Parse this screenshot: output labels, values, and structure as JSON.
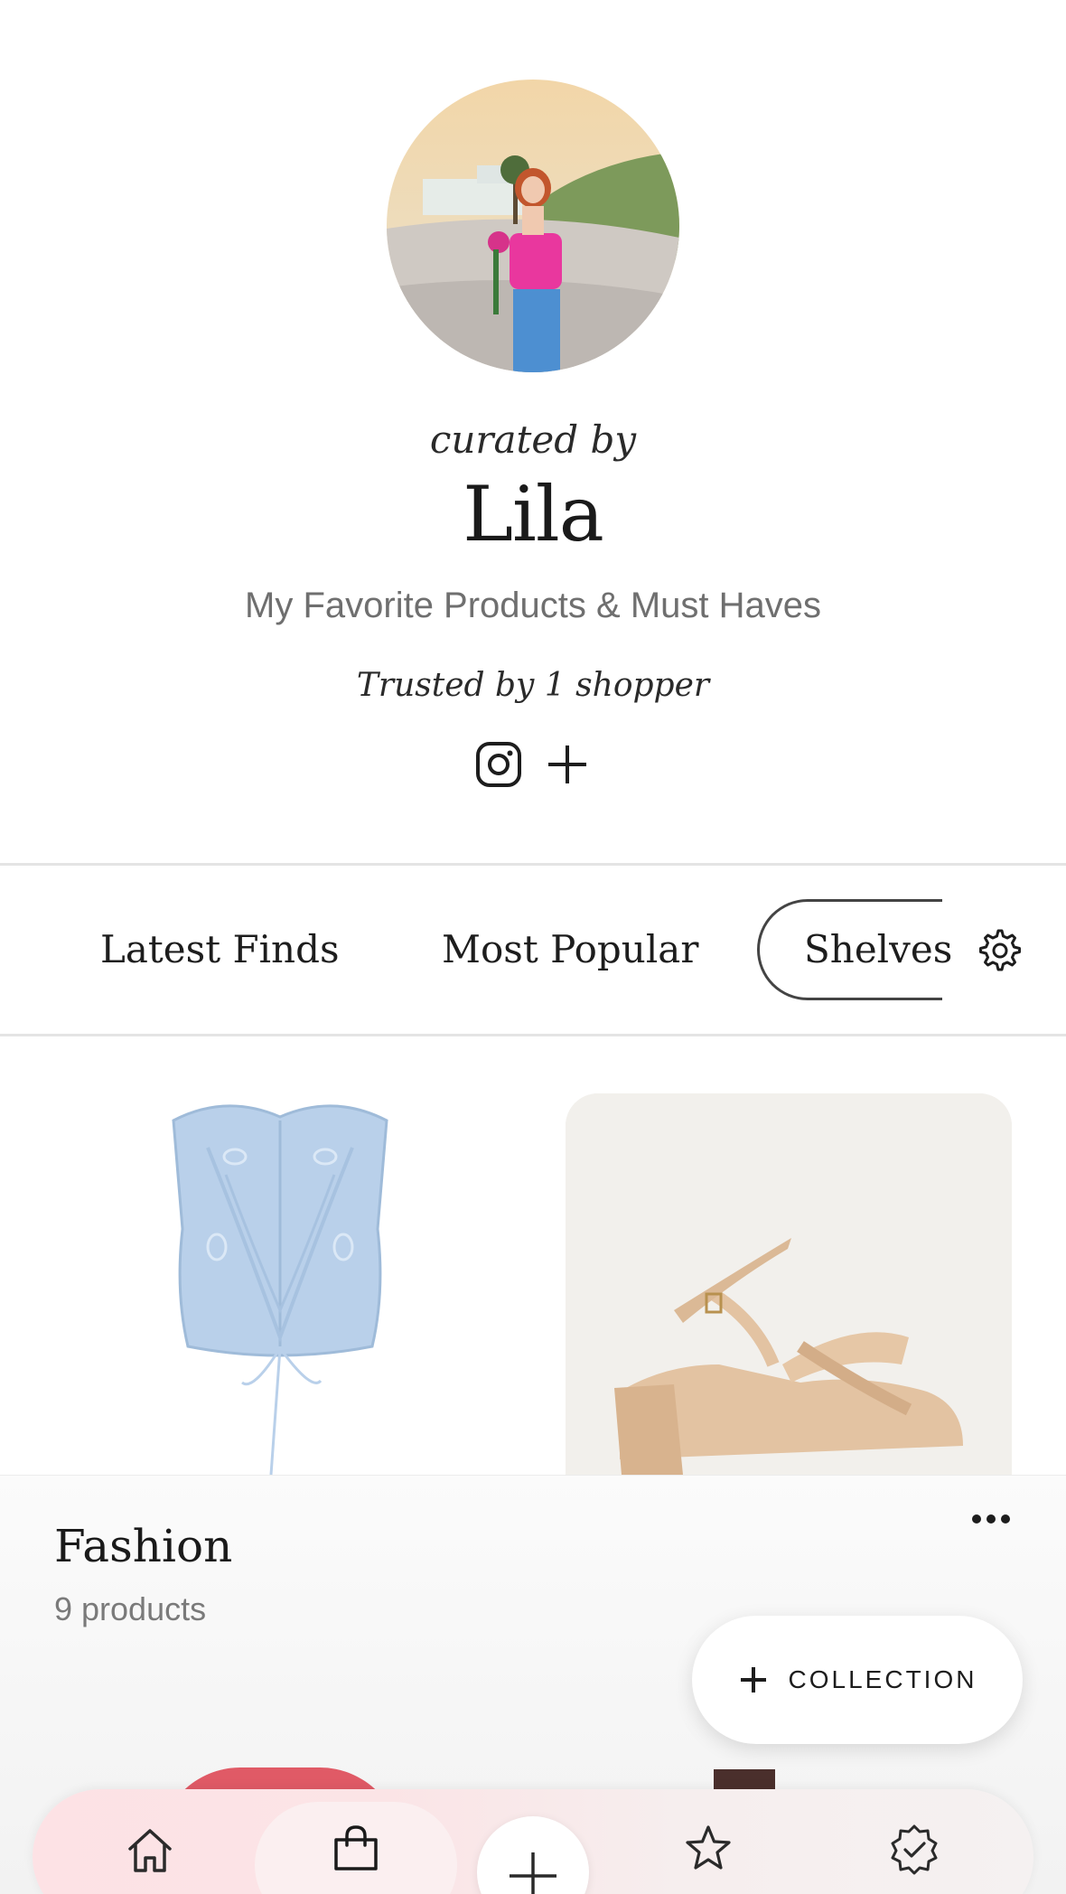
{
  "profile": {
    "curated_by": "curated by",
    "name": "Lila",
    "tagline": "My Favorite Products & Must Haves",
    "trusted": "Trusted by 1 shopper",
    "social_icons": [
      "instagram-icon",
      "plus-icon"
    ]
  },
  "tabs": [
    {
      "label": "Latest Finds",
      "active": false
    },
    {
      "label": "Most Popular",
      "active": false
    },
    {
      "label": "Shelves",
      "active": true
    }
  ],
  "collection": {
    "title": "Fashion",
    "count": "9 products",
    "add_button_label": "COLLECTION"
  },
  "bottom_nav": {
    "items": [
      "home-icon",
      "shopping-bag-icon",
      "add-icon",
      "star-icon",
      "verified-badge-icon"
    ],
    "active": "shopping-bag-icon"
  },
  "colors": {
    "accent_pink": "#f7c9cf",
    "text_dark": "#1d1d1d",
    "text_muted": "#6f6f6f"
  }
}
